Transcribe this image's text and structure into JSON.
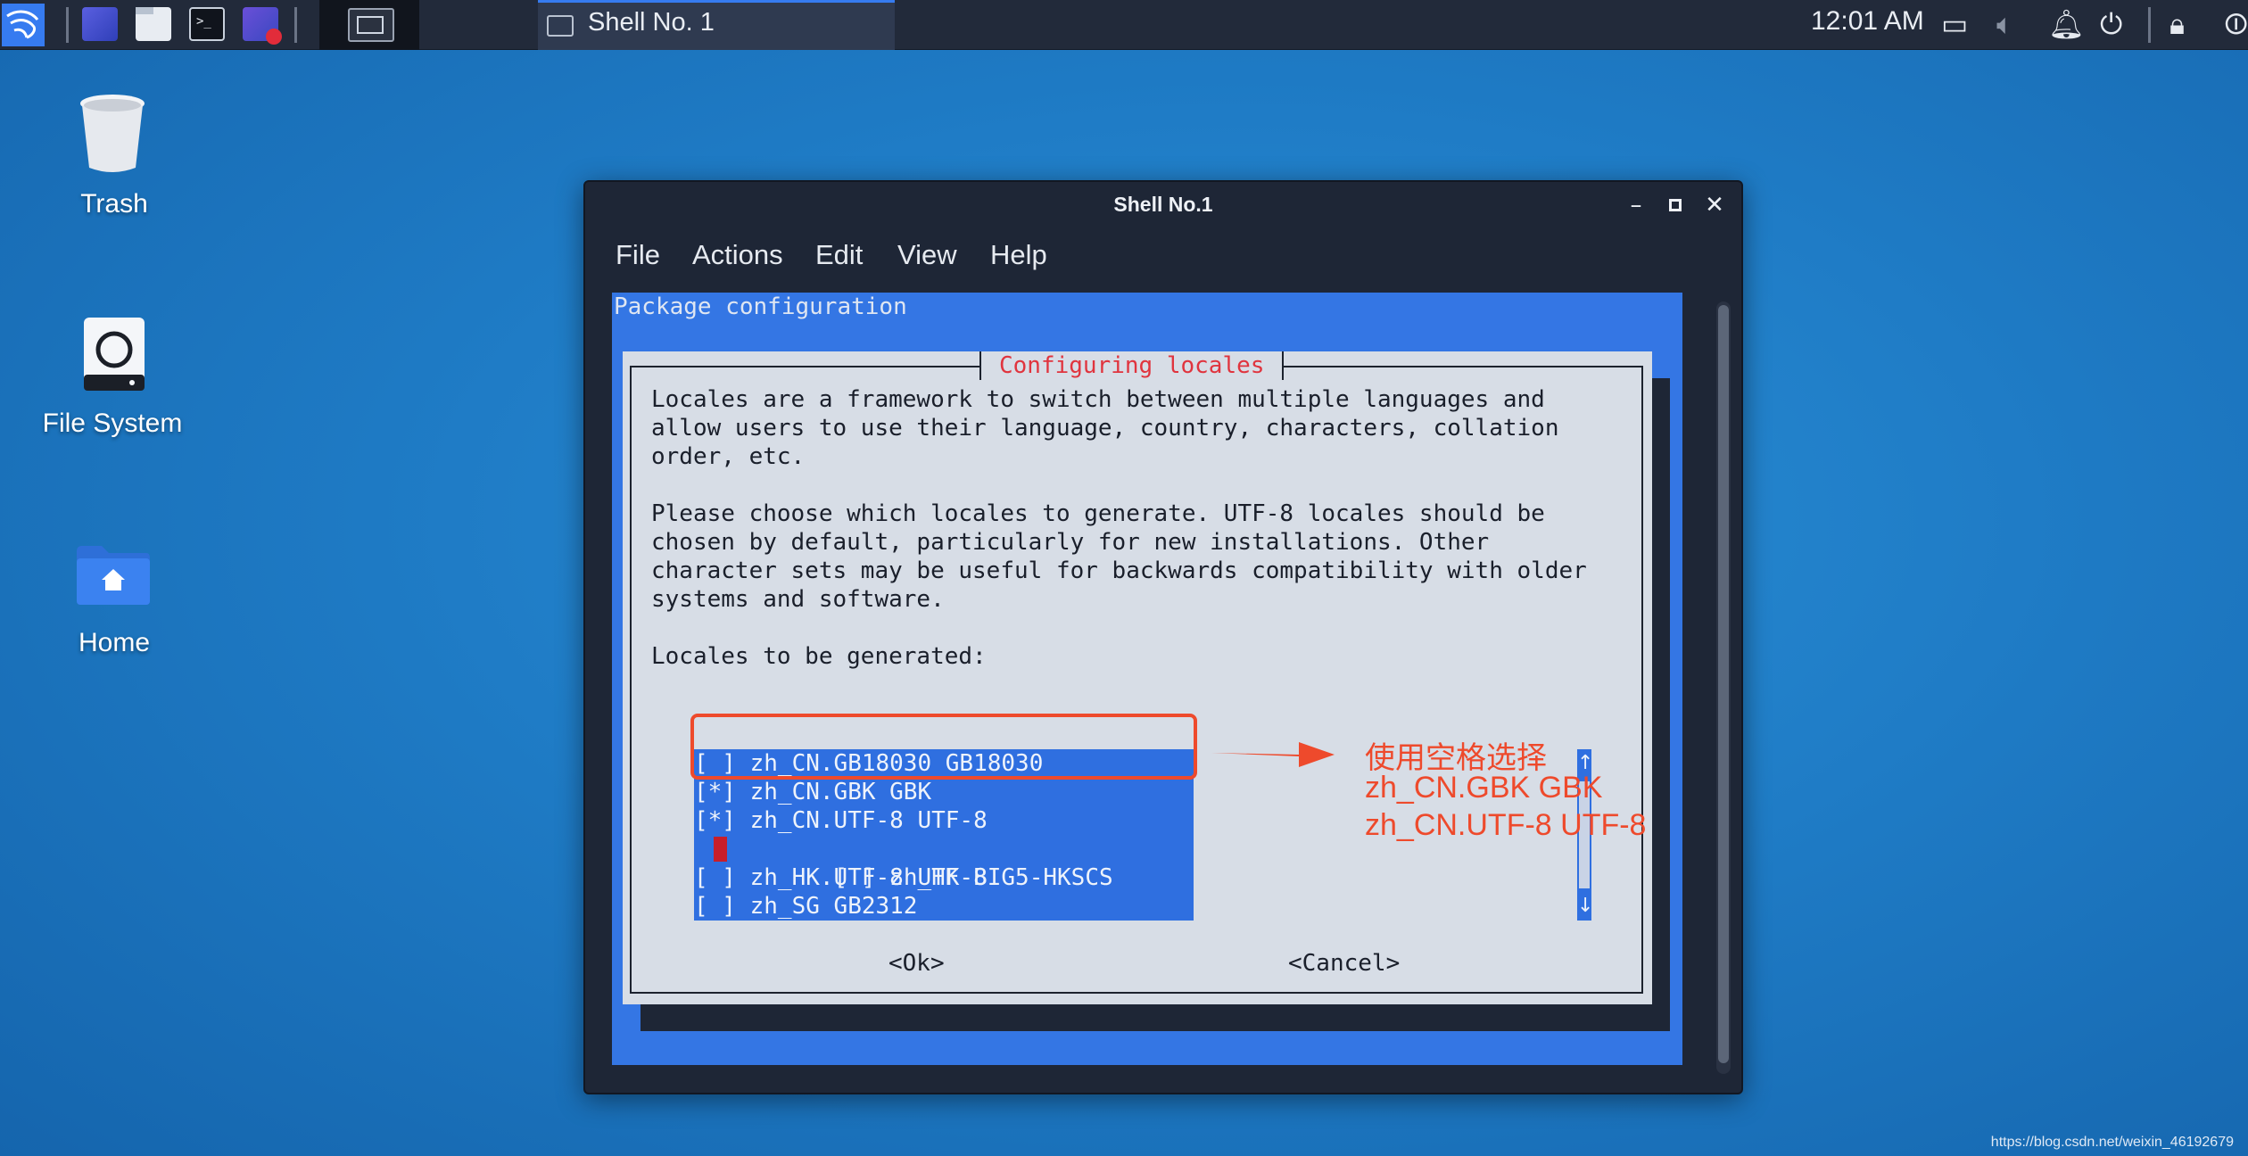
{
  "taskbar": {
    "clock": "12:01 AM",
    "task_label": "Shell No. 1",
    "launchers": [
      "kali-menu-icon",
      "workspace-icon",
      "file-manager-icon",
      "terminal-icon",
      "screen-recorder-icon"
    ],
    "status_icons": [
      "display-icon",
      "volume-icon",
      "notification-bell-icon",
      "power-icon",
      "lock-icon",
      "logout-icon"
    ]
  },
  "desktop": {
    "icons": [
      {
        "label": "Trash"
      },
      {
        "label": "File System"
      },
      {
        "label": "Home"
      }
    ]
  },
  "window": {
    "title": "Shell No.1",
    "menu": [
      "File",
      "Actions",
      "Edit",
      "View",
      "Help"
    ]
  },
  "terminal": {
    "header": "Package configuration",
    "dialog_title": "Configuring locales",
    "description": "Locales are a framework to switch between multiple languages and\nallow users to use their language, country, characters, collation\norder, etc.\n\nPlease choose which locales to generate. UTF-8 locales should be\nchosen by default, particularly for new installations. Other\ncharacter sets may be useful for backwards compatibility with older\nsystems and software.\n\nLocales to be generated:",
    "locales": [
      {
        "checkbox": "[ ]",
        "name": "zh_CN.GB18030 GB18030",
        "checked": false
      },
      {
        "checkbox": "[*]",
        "name": "zh_CN.GBK GBK",
        "checked": true
      },
      {
        "checkbox": "[*]",
        "name": "zh_CN.UTF-8 UTF-8",
        "checked": true
      },
      {
        "checkbox": "[ ]",
        "name": "zh_HK BIG5-HKSCS",
        "checked": false
      },
      {
        "checkbox": "[ ]",
        "name": "zh_HK.UTF-8 UTF-8",
        "checked": false
      },
      {
        "checkbox": "[ ]",
        "name": "zh_SG GB2312",
        "checked": false
      }
    ],
    "scroll_up": "↑",
    "scroll_down": "↓",
    "ok_button": "<Ok>",
    "cancel_button": "<Cancel>"
  },
  "annotation": {
    "line1": "使用空格选择",
    "line2": "zh_CN.GBK GBK",
    "line3": "zh_CN.UTF-8 UTF-8",
    "color": "#ee4a2c"
  },
  "watermark": "https://blog.csdn.net/weixin_46192679",
  "colors": {
    "taskbar": "#222a3a",
    "dialog_bg": "#3476e4",
    "dialog_title": "#e0343e",
    "accent": "#367bf0"
  }
}
